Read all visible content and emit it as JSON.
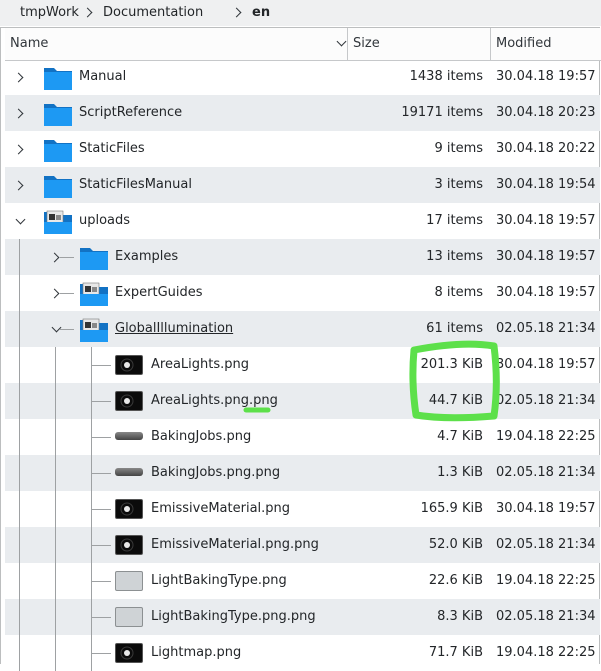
{
  "breadcrumb": [
    "tmpWork",
    "Documentation",
    "en"
  ],
  "header": {
    "name": "Name",
    "size": "Size",
    "modified": "Modified"
  },
  "colors": {
    "folder": "#1d99f3",
    "alt_row": "#e9ecef",
    "annotation": "#5de04a"
  },
  "rows": [
    {
      "name": "Manual",
      "size": "1438 items",
      "modified": "30.04.18 19:57",
      "kind": "folder",
      "depth": 0,
      "expander": "closed"
    },
    {
      "name": "ScriptReference",
      "size": "19171 items",
      "modified": "30.04.18 20:23",
      "kind": "folder",
      "depth": 0,
      "expander": "closed"
    },
    {
      "name": "StaticFiles",
      "size": "9 items",
      "modified": "30.04.18 20:22",
      "kind": "folder",
      "depth": 0,
      "expander": "closed"
    },
    {
      "name": "StaticFilesManual",
      "size": "3 items",
      "modified": "30.04.18 19:54",
      "kind": "folder",
      "depth": 0,
      "expander": "closed"
    },
    {
      "name": "uploads",
      "size": "17 items",
      "modified": "30.04.18 19:57",
      "kind": "folder-preview",
      "depth": 0,
      "expander": "open"
    },
    {
      "name": "Examples",
      "size": "13 items",
      "modified": "30.04.18 19:57",
      "kind": "folder",
      "depth": 1,
      "expander": "closed"
    },
    {
      "name": "ExpertGuides",
      "size": "8 items",
      "modified": "30.04.18 19:57",
      "kind": "folder-preview",
      "depth": 1,
      "expander": "closed"
    },
    {
      "name": "GlobalIllumination",
      "size": "61 items",
      "modified": "02.05.18 21:34",
      "kind": "folder-preview",
      "depth": 1,
      "expander": "open",
      "underline": true
    },
    {
      "name": "AreaLights.png",
      "size": "201.3 KiB",
      "modified": "30.04.18 19:57",
      "kind": "thumb-dark",
      "depth": 2
    },
    {
      "name": "AreaLights.png.png",
      "size": "44.7 KiB",
      "modified": "02.05.18 21:34",
      "kind": "thumb-dark",
      "depth": 2
    },
    {
      "name": "BakingJobs.png",
      "size": "4.7 KiB",
      "modified": "19.04.18 22:25",
      "kind": "thumb-bar",
      "depth": 2
    },
    {
      "name": "BakingJobs.png.png",
      "size": "1.3 KiB",
      "modified": "02.05.18 21:34",
      "kind": "thumb-bar",
      "depth": 2
    },
    {
      "name": "EmissiveMaterial.png",
      "size": "165.9 KiB",
      "modified": "30.04.18 19:57",
      "kind": "thumb-dark",
      "depth": 2
    },
    {
      "name": "EmissiveMaterial.png.png",
      "size": "52.0 KiB",
      "modified": "02.05.18 21:34",
      "kind": "thumb-dark",
      "depth": 2
    },
    {
      "name": "LightBakingType.png",
      "size": "22.6 KiB",
      "modified": "19.04.18 22:25",
      "kind": "thumb-gray",
      "depth": 2
    },
    {
      "name": "LightBakingType.png.png",
      "size": "8.3 KiB",
      "modified": "02.05.18 21:34",
      "kind": "thumb-gray",
      "depth": 2
    },
    {
      "name": "Lightmap.png",
      "size": "71.7 KiB",
      "modified": "19.04.18 22:25",
      "kind": "thumb-dark",
      "depth": 2
    }
  ]
}
